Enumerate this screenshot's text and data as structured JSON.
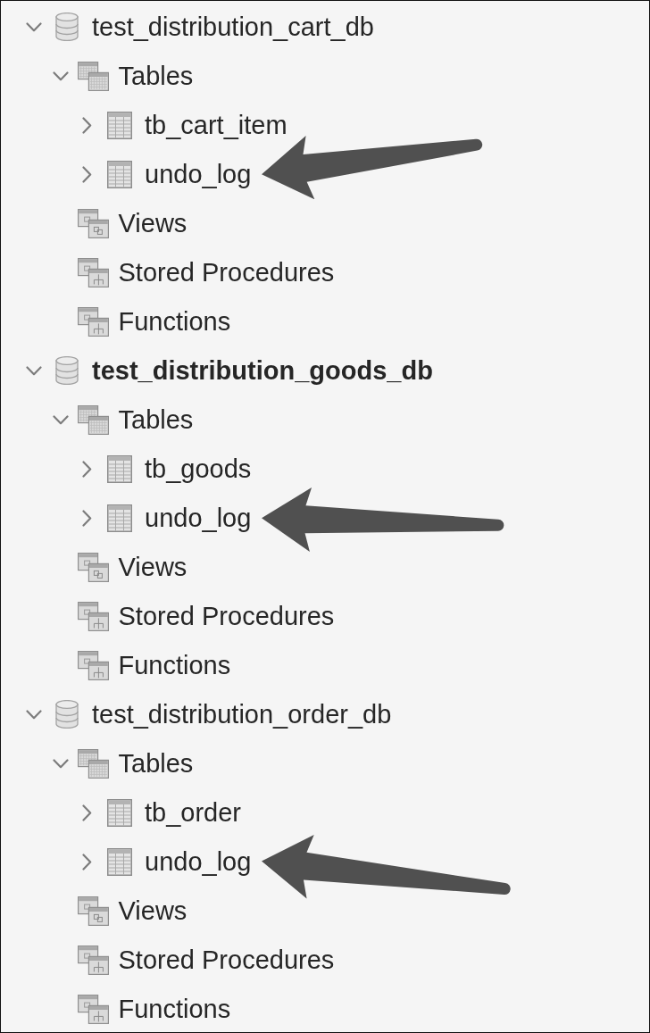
{
  "databases": [
    {
      "name": "test_distribution_cart_db",
      "kind": "database",
      "expanded": true,
      "default": false,
      "children": [
        {
          "name": "Tables",
          "kind": "tables",
          "expanded": true,
          "children": [
            {
              "name": "tb_cart_item",
              "kind": "table",
              "expanded": false,
              "pointed_at": false
            },
            {
              "name": "undo_log",
              "kind": "table",
              "expanded": false,
              "pointed_at": true
            }
          ]
        },
        {
          "name": "Views",
          "kind": "views"
        },
        {
          "name": "Stored Procedures",
          "kind": "procedures"
        },
        {
          "name": "Functions",
          "kind": "functions"
        }
      ]
    },
    {
      "name": "test_distribution_goods_db",
      "kind": "database",
      "expanded": true,
      "default": true,
      "children": [
        {
          "name": "Tables",
          "kind": "tables",
          "expanded": true,
          "children": [
            {
              "name": "tb_goods",
              "kind": "table",
              "expanded": false,
              "pointed_at": false
            },
            {
              "name": "undo_log",
              "kind": "table",
              "expanded": false,
              "pointed_at": true
            }
          ]
        },
        {
          "name": "Views",
          "kind": "views"
        },
        {
          "name": "Stored Procedures",
          "kind": "procedures"
        },
        {
          "name": "Functions",
          "kind": "functions"
        }
      ]
    },
    {
      "name": "test_distribution_order_db",
      "kind": "database",
      "expanded": true,
      "default": false,
      "children": [
        {
          "name": "Tables",
          "kind": "tables",
          "expanded": true,
          "children": [
            {
              "name": "tb_order",
              "kind": "table",
              "expanded": false,
              "pointed_at": false
            },
            {
              "name": "undo_log",
              "kind": "table",
              "expanded": false,
              "pointed_at": true
            }
          ]
        },
        {
          "name": "Views",
          "kind": "views"
        },
        {
          "name": "Stored Procedures",
          "kind": "procedures"
        },
        {
          "name": "Functions",
          "kind": "functions"
        }
      ]
    }
  ]
}
